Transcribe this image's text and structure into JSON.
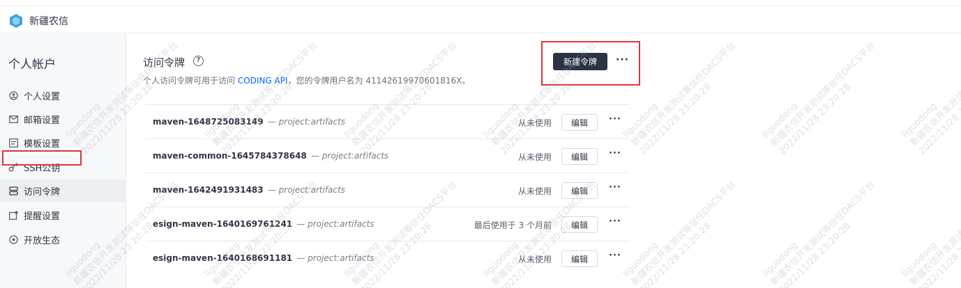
{
  "app": {
    "brand_name": "新疆农信"
  },
  "sidebar": {
    "title": "个人帐户",
    "items": [
      {
        "label": "个人设置",
        "icon": "user-circle-icon"
      },
      {
        "label": "邮箱设置",
        "icon": "mail-icon"
      },
      {
        "label": "模板设置",
        "icon": "template-icon"
      },
      {
        "label": "SSH公钥",
        "icon": "key-icon"
      },
      {
        "label": "访问令牌",
        "icon": "token-icon",
        "active": true
      },
      {
        "label": "提醒设置",
        "icon": "bell-icon"
      },
      {
        "label": "开放生态",
        "icon": "ecosystem-icon"
      }
    ]
  },
  "main": {
    "title": "访问令牌",
    "help_glyph": "?",
    "description_prefix": "个人访问令牌可用于访问 ",
    "description_link": "CODING API",
    "description_suffix": "，您的令牌用户名为 41142619970601816X。",
    "new_token_label": "新建令牌",
    "more_label": "···"
  },
  "tokens": [
    {
      "name": "maven-1648725083149",
      "scope": "— project:artifacts",
      "usage": "从未使用",
      "edit_label": "编辑",
      "more": "···"
    },
    {
      "name": "maven-common-1645784378648",
      "scope": "— project:artifacts",
      "usage": "从未使用",
      "edit_label": "编辑",
      "more": "···"
    },
    {
      "name": "maven-1642491931483",
      "scope": "— project:artifacts",
      "usage": "从未使用",
      "edit_label": "编辑",
      "more": "···"
    },
    {
      "name": "esign-maven-1640169761241",
      "scope": "— project:artifacts",
      "usage": "最后使用于 3 个月前",
      "edit_label": "编辑",
      "more": "···"
    },
    {
      "name": "esign-maven-1640168691181",
      "scope": "— project:artifacts",
      "usage": "从未使用",
      "edit_label": "编辑",
      "more": "···"
    }
  ],
  "watermark": {
    "user": "liguodong",
    "org": "新疆农信开发测试等信任DACS平台",
    "time": "2022/11/28 23:20:28"
  },
  "colors": {
    "accent_link": "#0066ff",
    "primary_button": "#2b3344",
    "highlight_box": "#d9363e"
  }
}
